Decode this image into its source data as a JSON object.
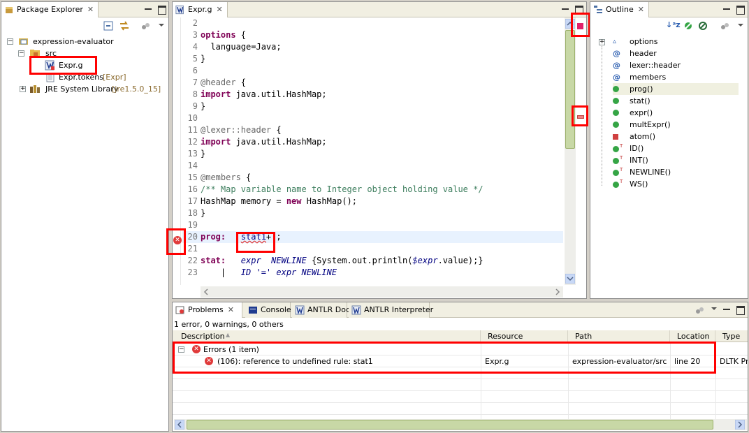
{
  "package_explorer": {
    "title": "Package Explorer",
    "tree": [
      {
        "label": "expression-evaluator"
      },
      {
        "label": "src"
      },
      {
        "label": "Expr.g"
      },
      {
        "label": "Expr.tokens",
        "decor": "[Expr]"
      },
      {
        "label": "JRE System Library",
        "decor": "[jre1.5.0_15]"
      }
    ]
  },
  "editor": {
    "tab": "Expr.g",
    "lines": [
      {
        "n": "2",
        "parts": []
      },
      {
        "n": "3",
        "parts": [
          {
            "t": "options",
            "c": "kw"
          },
          {
            "t": " {",
            "c": ""
          }
        ]
      },
      {
        "n": "4",
        "parts": [
          {
            "t": "  language=Java;",
            "c": ""
          }
        ]
      },
      {
        "n": "5",
        "parts": [
          {
            "t": "}",
            "c": ""
          }
        ]
      },
      {
        "n": "6",
        "parts": []
      },
      {
        "n": "7",
        "parts": [
          {
            "t": "@header",
            "c": "at"
          },
          {
            "t": " {",
            "c": ""
          }
        ]
      },
      {
        "n": "8",
        "parts": [
          {
            "t": "import",
            "c": "kw"
          },
          {
            "t": " java.util.HashMap;",
            "c": ""
          }
        ]
      },
      {
        "n": "9",
        "parts": [
          {
            "t": "}",
            "c": ""
          }
        ]
      },
      {
        "n": "10",
        "parts": []
      },
      {
        "n": "11",
        "parts": [
          {
            "t": "@lexer::header",
            "c": "at"
          },
          {
            "t": " {",
            "c": ""
          }
        ]
      },
      {
        "n": "12",
        "parts": [
          {
            "t": "import",
            "c": "kw"
          },
          {
            "t": " java.util.HashMap;",
            "c": ""
          }
        ]
      },
      {
        "n": "13",
        "parts": [
          {
            "t": "}",
            "c": ""
          }
        ]
      },
      {
        "n": "14",
        "parts": []
      },
      {
        "n": "15",
        "parts": [
          {
            "t": "@members",
            "c": "at"
          },
          {
            "t": " {",
            "c": ""
          }
        ]
      },
      {
        "n": "16",
        "parts": [
          {
            "t": "/** Map variable name to Integer object holding value */",
            "c": "cm"
          }
        ]
      },
      {
        "n": "17",
        "parts": [
          {
            "t": "HashMap memory = ",
            "c": ""
          },
          {
            "t": "new",
            "c": "kw"
          },
          {
            "t": " HashMap();",
            "c": ""
          }
        ]
      },
      {
        "n": "18",
        "parts": [
          {
            "t": "}",
            "c": ""
          }
        ]
      },
      {
        "n": "19",
        "parts": []
      },
      {
        "n": "20",
        "parts": [
          {
            "t": "prog:   ",
            "c": "kw"
          },
          {
            "t": "stat1",
            "c": "err"
          },
          {
            "t": "+ ;",
            "c": ""
          }
        ]
      },
      {
        "n": "21",
        "parts": []
      },
      {
        "n": "22",
        "parts": [
          {
            "t": "stat:   ",
            "c": "kw"
          },
          {
            "t": "expr",
            "c": "it"
          },
          {
            "t": "  ",
            "c": ""
          },
          {
            "t": "NEWLINE",
            "c": "it"
          },
          {
            "t": " {System.out.println(",
            "c": ""
          },
          {
            "t": "$expr",
            "c": "it"
          },
          {
            "t": ".value);}",
            "c": ""
          }
        ]
      },
      {
        "n": "23",
        "parts": [
          {
            "t": "    |   ",
            "c": ""
          },
          {
            "t": "ID",
            "c": "it"
          },
          {
            "t": " '=' ",
            "c": "it"
          },
          {
            "t": "expr",
            "c": "it"
          },
          {
            "t": " ",
            "c": ""
          },
          {
            "t": "NEWLINE",
            "c": "it"
          }
        ]
      }
    ]
  },
  "outline": {
    "title": "Outline",
    "items": [
      {
        "label": "options",
        "icon": "triangle"
      },
      {
        "label": "header",
        "icon": "at"
      },
      {
        "label": "lexer::header",
        "icon": "at"
      },
      {
        "label": "members",
        "icon": "at"
      },
      {
        "label": "prog()",
        "icon": "green"
      },
      {
        "label": "stat()",
        "icon": "green"
      },
      {
        "label": "expr()",
        "icon": "green"
      },
      {
        "label": "multExpr()",
        "icon": "green"
      },
      {
        "label": "atom()",
        "icon": "red"
      },
      {
        "label": "ID()",
        "icon": "token"
      },
      {
        "label": "INT()",
        "icon": "token"
      },
      {
        "label": "NEWLINE()",
        "icon": "token"
      },
      {
        "label": "WS()",
        "icon": "token"
      }
    ]
  },
  "bottom": {
    "tabs": [
      "Problems",
      "Console",
      "ANTLR Doc",
      "ANTLR Interpreter"
    ],
    "summary": "1 error, 0 warnings, 0 others",
    "columns": [
      "Description",
      "Resource",
      "Path",
      "Location",
      "Type"
    ],
    "group": "Errors (1 item)",
    "row": {
      "description": "(106): reference to undefined rule: stat1",
      "resource": "Expr.g",
      "path": "expression-evaluator/src",
      "location": "line 20",
      "type": "DLTK Problem"
    }
  },
  "colors": {
    "highlight": "#ff0000",
    "current_line": "#e8f2fe",
    "keyword": "#7f0055"
  }
}
